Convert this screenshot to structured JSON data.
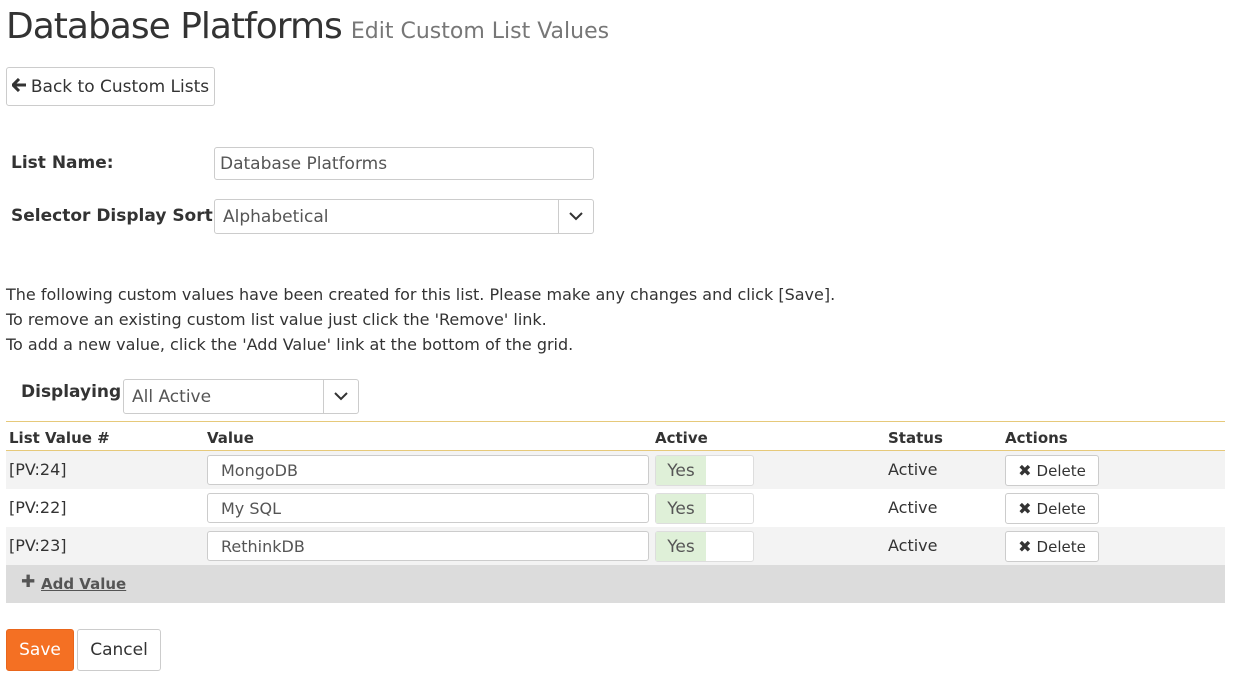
{
  "header": {
    "title": "Database Platforms",
    "subtitle": "Edit Custom List Values"
  },
  "back_button": {
    "label": "Back to Custom Lists",
    "icon": "arrow-left-icon"
  },
  "form": {
    "list_name_label": "List Name:",
    "list_name_value": "Database Platforms",
    "sorting_label": "Selector Display Sorting:",
    "sorting_value": "Alphabetical"
  },
  "instructions": [
    "The following custom values have been created for this list. Please make any changes and click [Save].",
    "To remove an existing custom list value just click the 'Remove' link.",
    "To add a new value, click the 'Add Value' link at the bottom of the grid."
  ],
  "filter": {
    "label": "Displaying:",
    "value": "All Active"
  },
  "grid": {
    "columns": [
      "List Value #",
      "Value",
      "Active",
      "Status",
      "Actions"
    ],
    "rows": [
      {
        "id": "[PV:24]",
        "value": "MongoDB",
        "active": "Yes",
        "status": "Active",
        "action": "Delete"
      },
      {
        "id": "[PV:22]",
        "value": "My SQL",
        "active": "Yes",
        "status": "Active",
        "action": "Delete"
      },
      {
        "id": "[PV:23]",
        "value": "RethinkDB",
        "active": "Yes",
        "status": "Active",
        "action": "Delete"
      }
    ],
    "add_value_label": "Add Value"
  },
  "footer": {
    "save_label": "Save",
    "cancel_label": "Cancel"
  },
  "colors": {
    "accent": "#f47023",
    "active_toggle": "#dff0d8",
    "header_border": "#e6c97a"
  }
}
